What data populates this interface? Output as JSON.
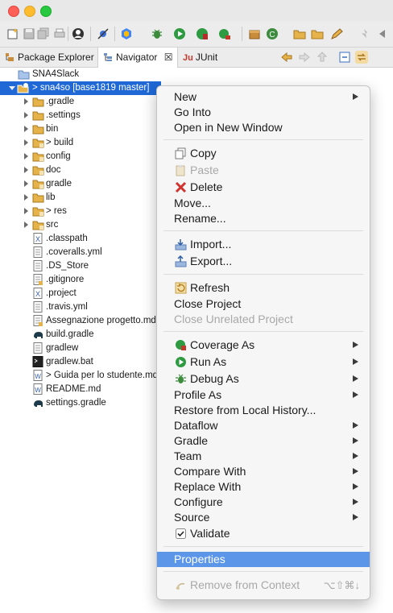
{
  "window": {
    "buttons": [
      "close-button",
      "minimize-button",
      "zoom-button"
    ]
  },
  "tabs": [
    {
      "label": "Package Explorer"
    },
    {
      "label": "Navigator",
      "close": "☒"
    },
    {
      "label": "JUnit"
    }
  ],
  "tree": {
    "workspace_root": "SNA4Slack",
    "project": "> sna4so [base1819 master]",
    "items": [
      {
        "label": ".gradle"
      },
      {
        "label": ".settings"
      },
      {
        "label": "bin"
      },
      {
        "label": "> build"
      },
      {
        "label": "config"
      },
      {
        "label": "doc"
      },
      {
        "label": "gradle"
      },
      {
        "label": "lib"
      },
      {
        "label": "> res"
      },
      {
        "label": "src"
      },
      {
        "label": ".classpath"
      },
      {
        "label": ".coveralls.yml"
      },
      {
        "label": ".DS_Store"
      },
      {
        "label": ".gitignore"
      },
      {
        "label": ".project"
      },
      {
        "label": ".travis.yml"
      },
      {
        "label": "Assegnazione progetto.md"
      },
      {
        "label": "build.gradle"
      },
      {
        "label": "gradlew"
      },
      {
        "label": "gradlew.bat"
      },
      {
        "label": "> Guida per lo studente.md"
      },
      {
        "label": "README.md"
      },
      {
        "label": "settings.gradle"
      }
    ]
  },
  "menu": {
    "new": "New",
    "go_into": "Go Into",
    "open_new_window": "Open in New Window",
    "copy": "Copy",
    "paste": "Paste",
    "delete": "Delete",
    "move": "Move...",
    "rename": "Rename...",
    "import": "Import...",
    "export": "Export...",
    "refresh": "Refresh",
    "close_project": "Close Project",
    "close_unrelated": "Close Unrelated Project",
    "coverage_as": "Coverage As",
    "run_as": "Run As",
    "debug_as": "Debug As",
    "profile_as": "Profile As",
    "restore_history": "Restore from Local History...",
    "dataflow": "Dataflow",
    "gradle": "Gradle",
    "team": "Team",
    "compare_with": "Compare With",
    "replace_with": "Replace With",
    "configure": "Configure",
    "source": "Source",
    "validate": "Validate",
    "properties": "Properties",
    "remove_from_context": "Remove from Context",
    "remove_shortcut": "⌥⇧⌘↓"
  },
  "colors": {
    "selection": "#1f68d6",
    "menu_highlight": "#5b96e8",
    "folder": "#e6b24a"
  }
}
